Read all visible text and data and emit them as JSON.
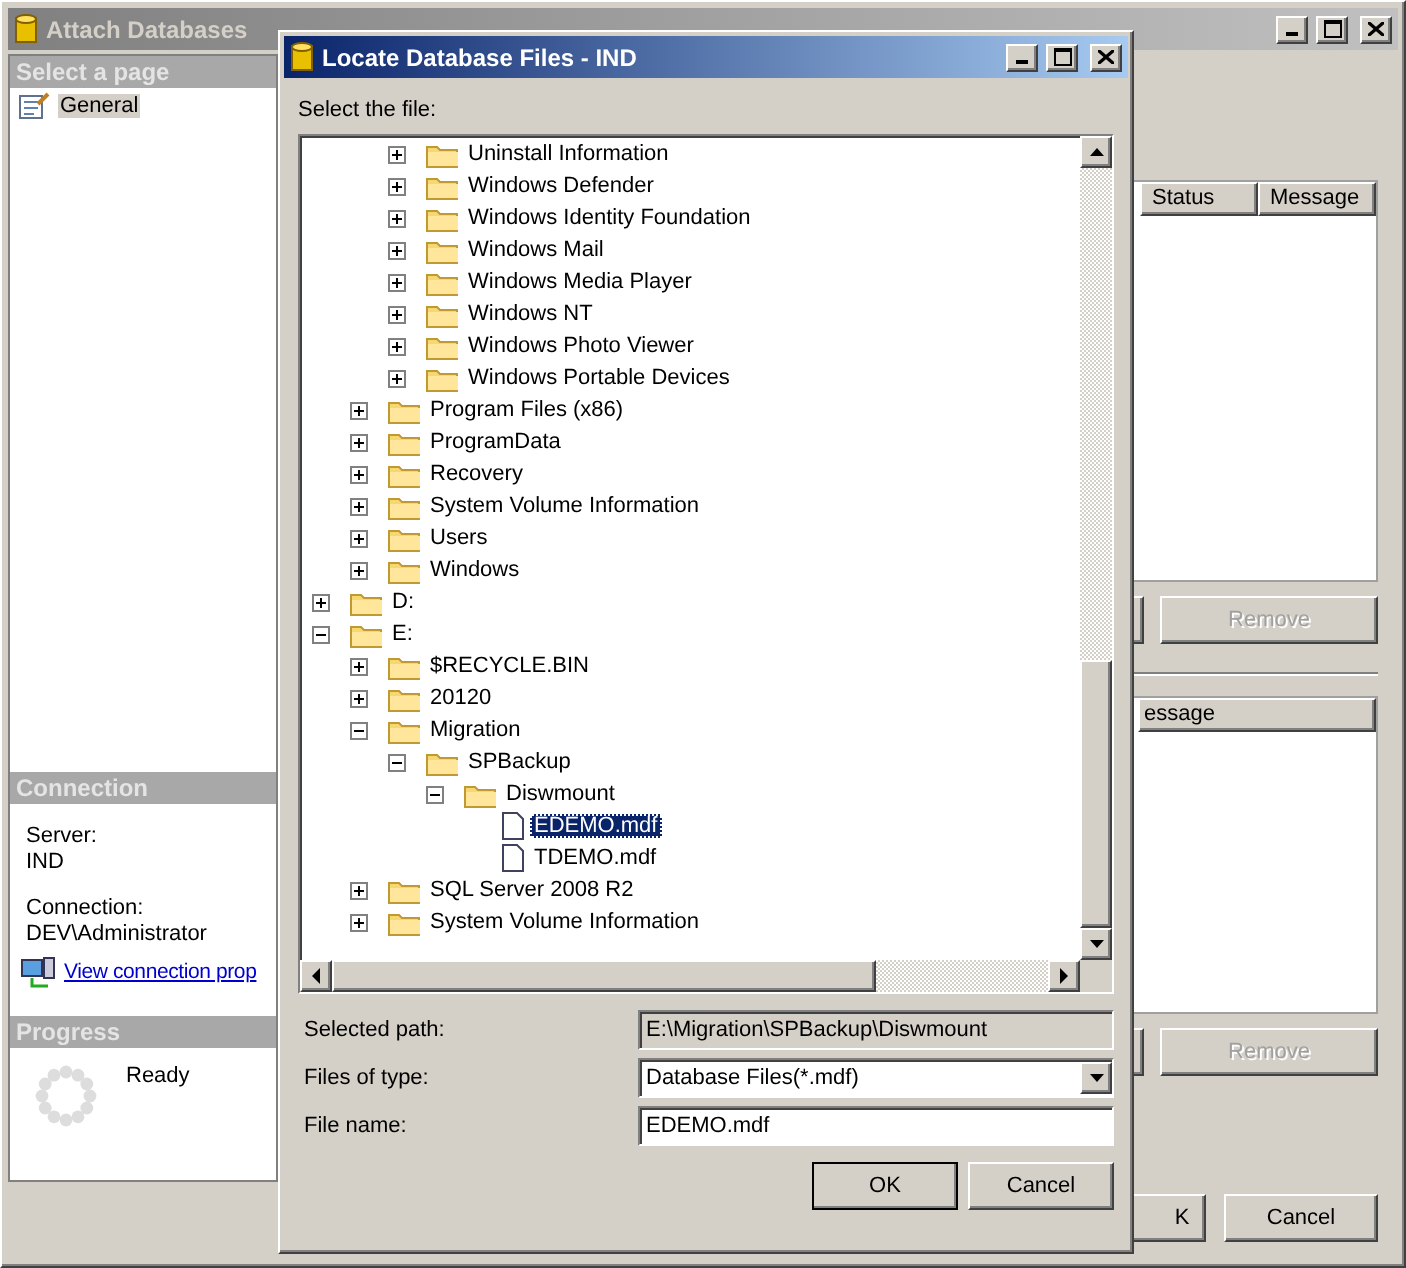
{
  "main_window": {
    "title": "Attach Databases",
    "sidebar": {
      "header": "Select a page",
      "pages": [
        {
          "label": "General",
          "selected": true
        }
      ]
    },
    "connection": {
      "header": "Connection",
      "server_label": "Server:",
      "server": "IND",
      "connection_label": "Connection:",
      "connection": "DEV\\Administrator",
      "link": "View connection prop"
    },
    "progress": {
      "header": "Progress",
      "status": "Ready"
    },
    "databases_grid": {
      "columns": [
        "Status",
        "Message"
      ],
      "button": {
        "label": "Remove",
        "disabled": true
      }
    },
    "details_grid": {
      "columns": [
        "essage"
      ],
      "button": {
        "label": "Remove",
        "disabled": true
      }
    },
    "buttons": [
      {
        "label": "K"
      },
      {
        "label": "Cancel"
      }
    ]
  },
  "dialog": {
    "title": "Locate Database Files - IND",
    "prompt": "Select the file:",
    "tree": [
      {
        "kind": "offscreen",
        "children": [
          {
            "kind": "offscreen",
            "children": [
              {
                "kind": "folder",
                "label": "Uninstall Information",
                "expanded": false,
                "selected": false
              },
              {
                "kind": "folder",
                "label": "Windows Defender",
                "expanded": false,
                "selected": false
              },
              {
                "kind": "folder",
                "label": "Windows Identity Foundation",
                "expanded": false,
                "selected": false
              },
              {
                "kind": "folder",
                "label": "Windows Mail",
                "expanded": false,
                "selected": false
              },
              {
                "kind": "folder",
                "label": "Windows Media Player",
                "expanded": false,
                "selected": false
              },
              {
                "kind": "folder",
                "label": "Windows NT",
                "expanded": false,
                "selected": false
              },
              {
                "kind": "folder",
                "label": "Windows Photo Viewer",
                "expanded": false,
                "selected": false
              },
              {
                "kind": "folder",
                "label": "Windows Portable Devices",
                "expanded": false,
                "selected": false
              }
            ]
          },
          {
            "kind": "folder",
            "label": "Program Files (x86)",
            "expanded": false,
            "selected": false
          },
          {
            "kind": "folder",
            "label": "ProgramData",
            "expanded": false,
            "selected": false
          },
          {
            "kind": "folder",
            "label": "Recovery",
            "expanded": false,
            "selected": false
          },
          {
            "kind": "folder",
            "label": "System Volume Information",
            "expanded": false,
            "selected": false
          },
          {
            "kind": "folder",
            "label": "Users",
            "expanded": false,
            "selected": false
          },
          {
            "kind": "folder",
            "label": "Windows",
            "expanded": false,
            "selected": false
          }
        ]
      },
      {
        "kind": "folder",
        "label": "D:",
        "expanded": false,
        "selected": false
      },
      {
        "kind": "folder",
        "label": "E:",
        "expanded": true,
        "selected": false,
        "children": [
          {
            "kind": "folder",
            "label": "$RECYCLE.BIN",
            "expanded": false,
            "selected": false
          },
          {
            "kind": "folder",
            "label": "20120",
            "expanded": false,
            "selected": false
          },
          {
            "kind": "folder",
            "label": "Migration",
            "expanded": true,
            "selected": false,
            "children": [
              {
                "kind": "folder",
                "label": "SPBackup",
                "expanded": true,
                "selected": false,
                "children": [
                  {
                    "kind": "folder",
                    "label": "Diswmount",
                    "expanded": true,
                    "selected": false,
                    "children": [
                      {
                        "kind": "file",
                        "label": "EDEMO.mdf",
                        "selected": true
                      },
                      {
                        "kind": "file",
                        "label": "TDEMO.mdf",
                        "selected": false
                      }
                    ]
                  }
                ]
              }
            ]
          },
          {
            "kind": "folder",
            "label": "SQL Server 2008 R2",
            "expanded": false,
            "selected": false
          },
          {
            "kind": "folder",
            "label": "System Volume Information",
            "expanded": false,
            "selected": false
          }
        ]
      }
    ],
    "fields": [
      {
        "kind": "readonly",
        "label": "Selected path:",
        "value": "E:\\Migration\\SPBackup\\Diswmount"
      },
      {
        "kind": "dropdown",
        "label": "Files of type:",
        "value": "Database Files(*.mdf)"
      },
      {
        "kind": "text",
        "label": "File name:",
        "value": "EDEMO.mdf"
      }
    ],
    "buttons": [
      {
        "label": "OK",
        "default": true
      },
      {
        "label": "Cancel",
        "default": false
      }
    ]
  }
}
